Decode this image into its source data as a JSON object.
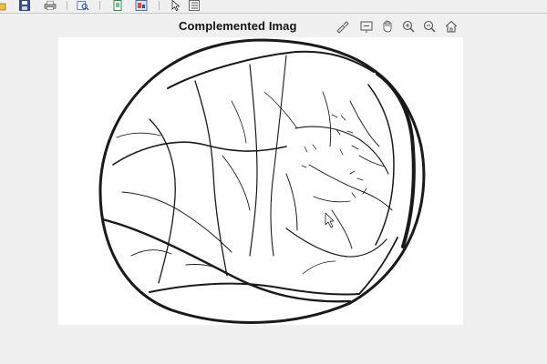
{
  "figure": {
    "title": "Complemented Imag"
  },
  "toolbar": {
    "buttons": [
      {
        "name": "open-file-icon"
      },
      {
        "name": "save-icon"
      },
      {
        "name": "print-icon"
      },
      {
        "name": "print-preview-icon"
      },
      {
        "name": "copy-figure-icon"
      },
      {
        "name": "figure-properties-icon"
      },
      {
        "name": "pointer-icon"
      },
      {
        "name": "property-editor-icon"
      }
    ]
  },
  "axes_toolbar": {
    "buttons": [
      {
        "name": "brush-icon"
      },
      {
        "name": "data-tip-icon"
      },
      {
        "name": "pan-icon"
      },
      {
        "name": "zoom-in-icon"
      },
      {
        "name": "zoom-out-icon"
      },
      {
        "name": "home-icon"
      }
    ]
  },
  "image": {
    "description_name": "vessel-map",
    "colors": {
      "ink": "#1a1a1a",
      "background": "#ffffff"
    }
  }
}
